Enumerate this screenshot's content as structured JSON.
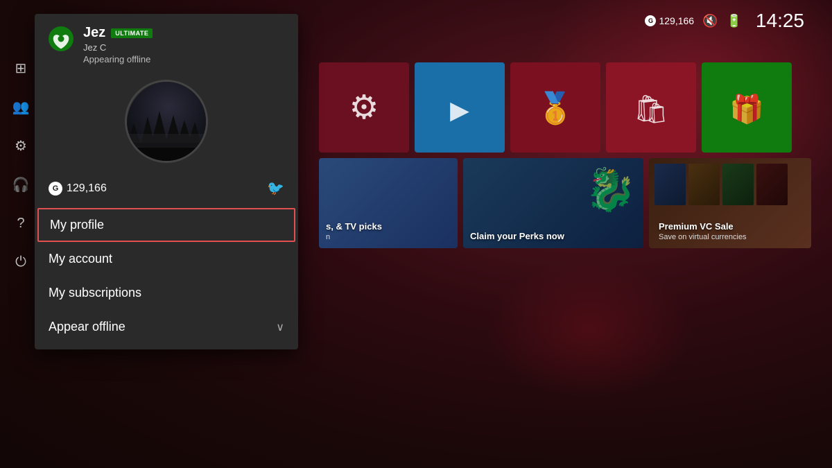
{
  "topbar": {
    "gamerscore": "129,166",
    "clock": "14:25"
  },
  "profile_panel": {
    "username": "Jez",
    "badge": "ULTIMATE",
    "real_name": "Jez C",
    "status": "Appearing offline",
    "gamerscore": "129,166",
    "menu": {
      "my_profile": "My profile",
      "my_account": "My account",
      "my_subscriptions": "My subscriptions",
      "appear_offline": "Appear offline"
    }
  },
  "tiles": [
    {
      "id": "settings",
      "color": "dark-red",
      "icon": "gear"
    },
    {
      "id": "media",
      "color": "blue",
      "icon": "play"
    },
    {
      "id": "achievements",
      "color": "maroon",
      "icon": "medal"
    },
    {
      "id": "store",
      "color": "store",
      "icon": "bag"
    },
    {
      "id": "gamepass",
      "color": "green",
      "icon": "gift"
    }
  ],
  "banners": [
    {
      "id": "picks",
      "text": "s, & TV picks",
      "subtext": "n"
    },
    {
      "id": "perks",
      "text": "Claim your Perks now"
    },
    {
      "id": "sale",
      "title": "Premium VC Sale",
      "subtitle": "Save on virtual currencies"
    }
  ],
  "sidebar_items": [
    {
      "id": "home",
      "icon": "⊞"
    },
    {
      "id": "social",
      "icon": "👥"
    },
    {
      "id": "settings",
      "icon": "⚙"
    },
    {
      "id": "headset",
      "icon": "🎧"
    },
    {
      "id": "help",
      "icon": "?"
    },
    {
      "id": "power",
      "icon": "⏻"
    }
  ]
}
